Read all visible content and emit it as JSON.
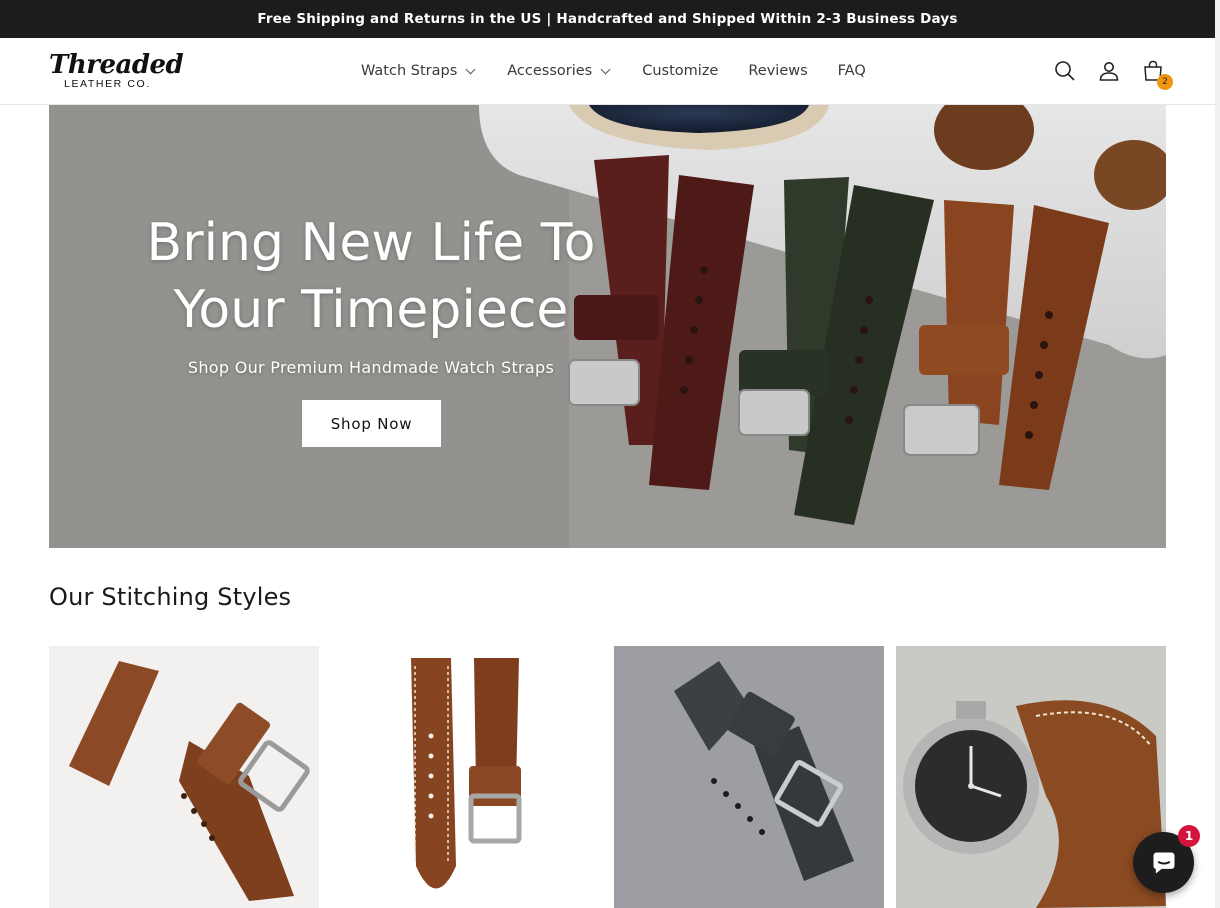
{
  "announcement": "Free Shipping and Returns in the US | Handcrafted and Shipped Within 2-3 Business Days",
  "logo": {
    "script": "Threaded",
    "sub": "LEATHER CO."
  },
  "nav": [
    {
      "label": "Watch Straps",
      "dropdown": true
    },
    {
      "label": "Accessories",
      "dropdown": true
    },
    {
      "label": "Customize",
      "dropdown": false
    },
    {
      "label": "Reviews",
      "dropdown": false
    },
    {
      "label": "FAQ",
      "dropdown": false
    }
  ],
  "header_icons": {
    "search": "search-icon",
    "account": "account-icon",
    "cart": "cart-icon",
    "cart_count": "2"
  },
  "hero": {
    "title_line1": "Bring New Life To",
    "title_line2": "Your Timepiece",
    "subtitle": "Shop Our Premium Handmade Watch Straps",
    "button": "Shop Now"
  },
  "stitching": {
    "title": "Our Stitching Styles",
    "cards": [
      {
        "image": "brown-strap-minimal-stitch"
      },
      {
        "image": "brown-strap-full-stitch"
      },
      {
        "image": "grey-strap-on-fabric"
      },
      {
        "image": "watch-with-brown-strap"
      }
    ]
  },
  "chat": {
    "icon": "chat-icon",
    "badge": "1"
  },
  "colors": {
    "announcement_bg": "#1c1c1c",
    "badge": "#f0960f",
    "chat_badge": "#d4143c",
    "chat_bg": "#1d1d1d"
  }
}
